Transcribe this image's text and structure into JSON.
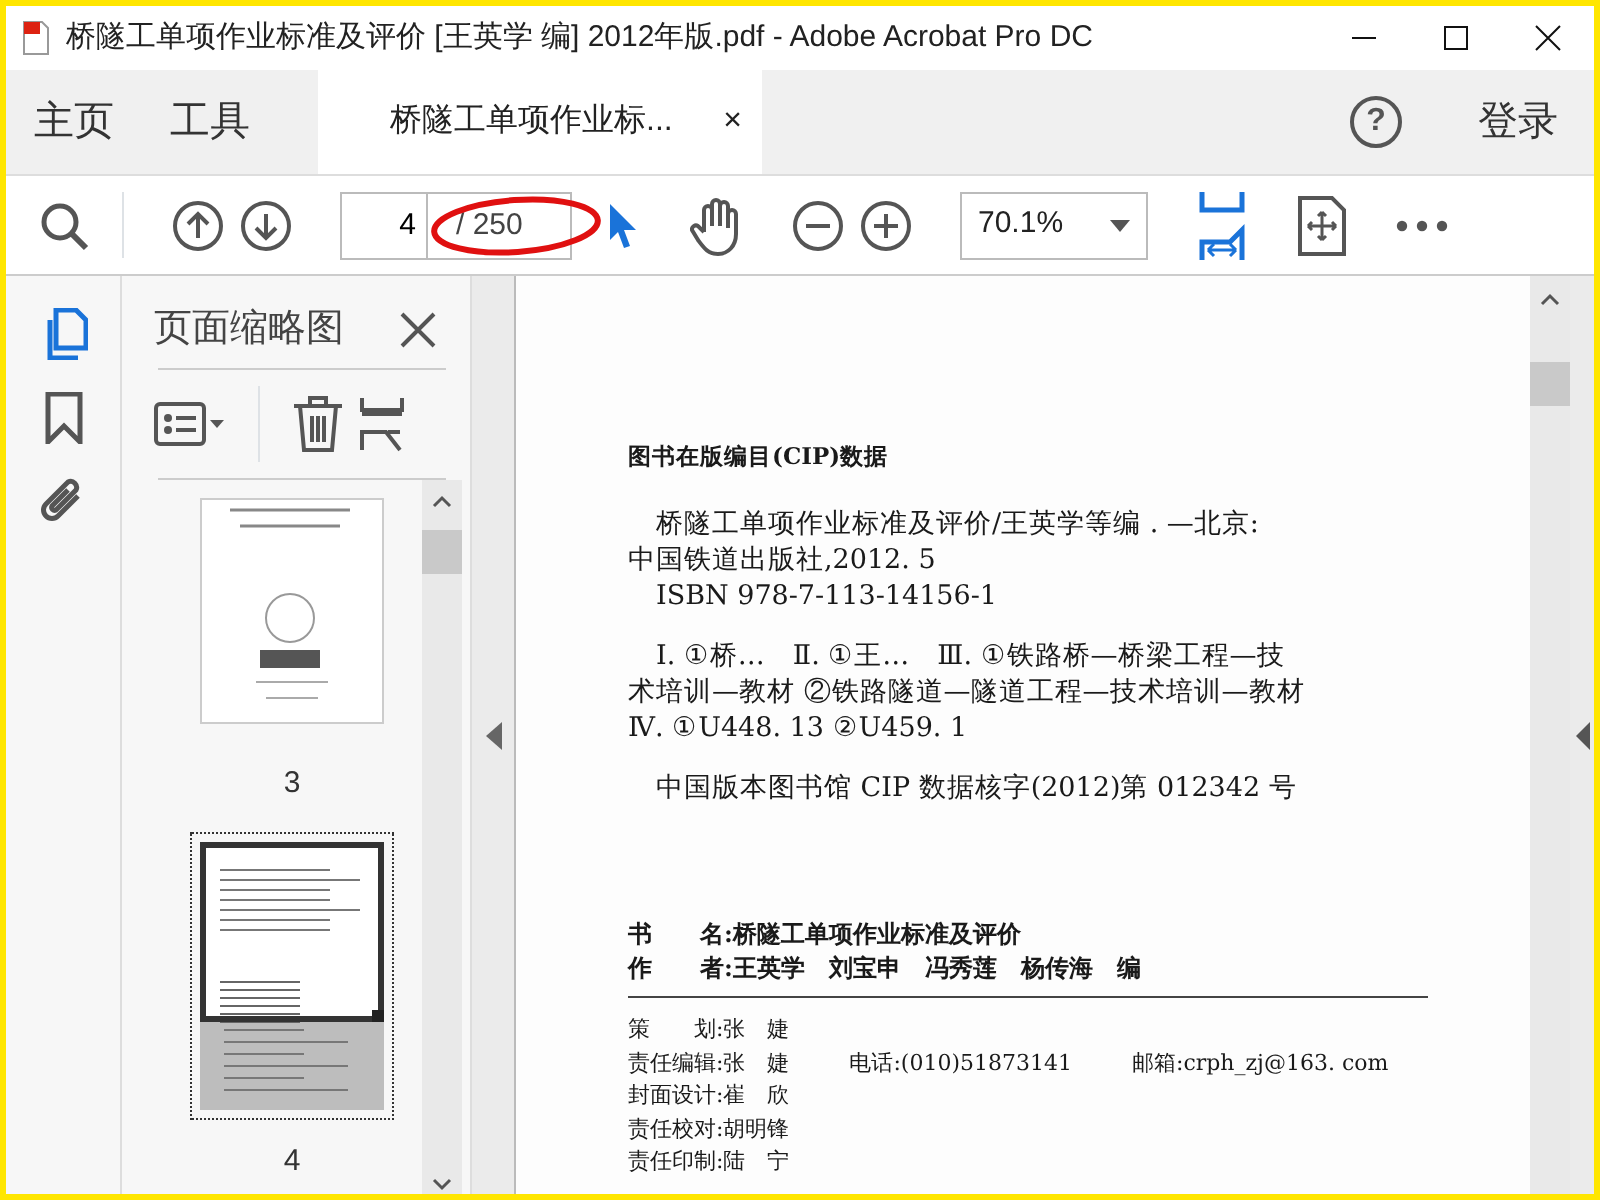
{
  "window": {
    "title": "桥隧工单项作业标准及评价 [王英学 编] 2012年版.pdf - Adobe Acrobat Pro DC"
  },
  "nav": [
    {
      "label": "主页"
    },
    {
      "label": "工具"
    }
  ],
  "tabs": [
    {
      "label": "桥隧工单项作业标...",
      "close": "×",
      "selected": true
    }
  ],
  "account": {
    "help": "?",
    "login": "登录"
  },
  "toolbar": {
    "page": "4",
    "page_total": "/ 250",
    "zoom": "70.1%"
  },
  "sidebar": {
    "title": "页面缩略图",
    "thumbnails": [
      {
        "label": "3",
        "selected": false
      },
      {
        "label": "4",
        "selected": true
      }
    ]
  },
  "document": {
    "blocks": [
      {
        "kind": "heading",
        "text": "图书在版编目(CIP)数据"
      },
      {
        "kind": "paragraph",
        "lines": [
          {
            "text": "桥隧工单项作业标准及评价/王英学等编 . —北京:",
            "indent": true
          },
          {
            "text": "中国铁道出版社,2012. 5",
            "indent": false
          },
          {
            "text": "ISBN 978-7-113-14156-1",
            "indent": true
          }
        ]
      },
      {
        "kind": "paragraph",
        "lines": [
          {
            "text": "Ⅰ. ①桥…　Ⅱ. ①王…　Ⅲ. ①铁路桥—桥梁工程—技",
            "indent": true
          },
          {
            "text": "术培训—教材 ②铁路隧道—隧道工程—技术培训—教材",
            "indent": false
          },
          {
            "text": "Ⅳ. ①U448. 13 ②U459. 1",
            "indent": false
          }
        ]
      },
      {
        "kind": "paragraph",
        "lines": [
          {
            "text": "中国版本图书馆 CIP 数据核字(2012)第 012342 号",
            "indent": true
          }
        ]
      },
      {
        "kind": "credits",
        "rows": [
          [
            "书　　名:桥隧工单项作业标准及评价"
          ],
          [
            "作　　者:王英学　刘宝申　冯秀莲　杨传海　编"
          ]
        ]
      },
      {
        "kind": "rule"
      },
      {
        "kind": "credits",
        "rows": [
          [
            "策　　划:张　婕"
          ],
          [
            "责任编辑:张　婕",
            "电话:(010)51873141",
            "邮箱:crph_zj@163. com"
          ],
          [
            "封面设计:崔　欣"
          ],
          [
            "责任校对:胡明锋"
          ],
          [
            "责任印制:陆　宁"
          ]
        ]
      }
    ]
  }
}
